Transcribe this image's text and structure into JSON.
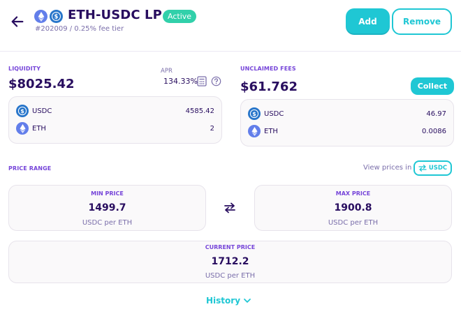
{
  "header": {
    "icons": [
      "arrow-left-icon",
      "eth-token-icon",
      "usdc-token-icon"
    ],
    "title": "ETH-USDC LP",
    "badge": "Active",
    "subtitle": "#202009 / 0.25% fee tier",
    "add_label": "Add",
    "remove_label": "Remove"
  },
  "liquidity": {
    "label": "LIQUIDITY",
    "value": "$8025.42",
    "apr_label": "APR",
    "apr_value": "134.33%",
    "icons": [
      "calculator-icon",
      "help-icon"
    ],
    "tokens": [
      {
        "symbol": "USDC",
        "amount": "4585.42",
        "icon": "usdc-token-icon"
      },
      {
        "symbol": "ETH",
        "amount": "2",
        "icon": "eth-token-icon"
      }
    ]
  },
  "fees": {
    "label": "UNCLAIMED FEES",
    "value": "$61.762",
    "collect_label": "Collect",
    "tokens": [
      {
        "symbol": "USDC",
        "amount": "46.97",
        "icon": "usdc-token-icon"
      },
      {
        "symbol": "ETH",
        "amount": "0.0086",
        "icon": "eth-token-icon"
      }
    ]
  },
  "price_range": {
    "label": "PRICE RANGE",
    "view_prices_label": "View prices in",
    "toggle_label": "USDC",
    "toggle_icon": "swap-horizontal-icon",
    "swap_icon": "swap-arrows-icon",
    "min": {
      "label": "MIN PRICE",
      "value": "1499.7",
      "unit": "USDC per ETH"
    },
    "max": {
      "label": "MAX PRICE",
      "value": "1900.8",
      "unit": "USDC per ETH"
    },
    "current": {
      "label": "CURRENT PRICE",
      "value": "1712.2",
      "unit": "USDC per ETH"
    }
  },
  "history": {
    "label": "History",
    "icon": "chevron-down-icon"
  },
  "colors": {
    "accent": "#1fc7d4",
    "text": "#280d5f",
    "secondary": "#7a6eaa",
    "label": "#7645d9",
    "success": "#31d0aa",
    "eth": "#627eea",
    "usdc": "#2775ca"
  }
}
